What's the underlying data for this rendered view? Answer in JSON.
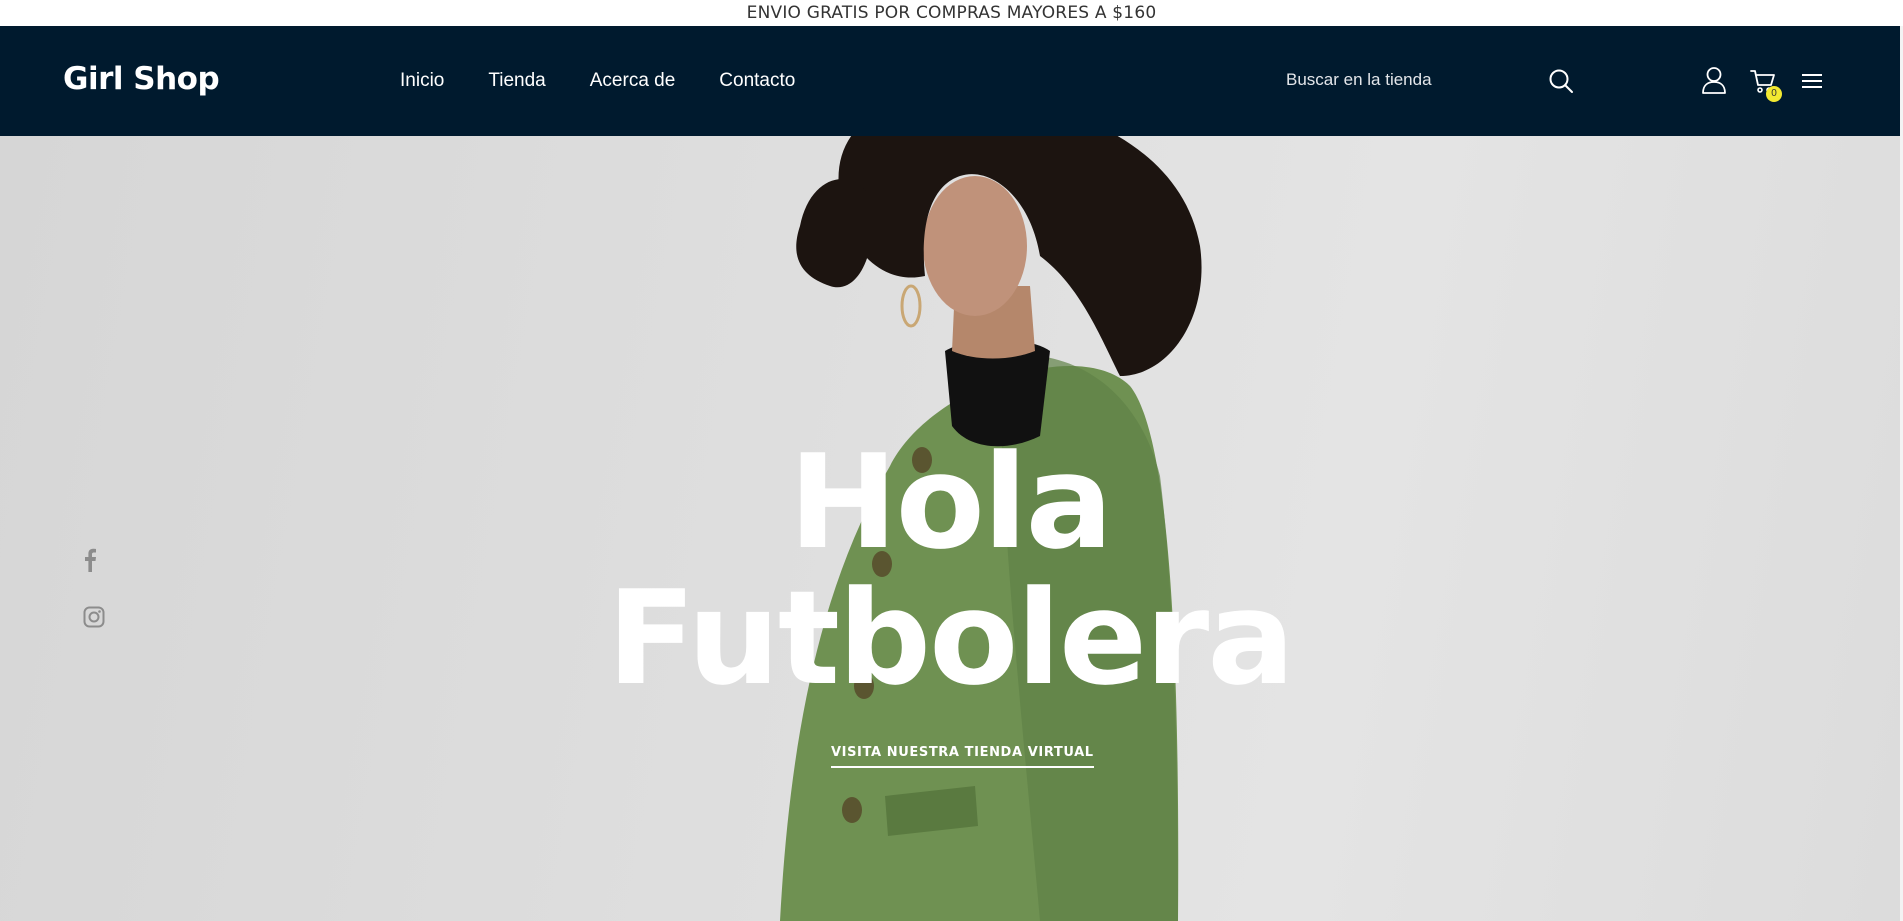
{
  "announcement": "ENVIO GRATIS POR COMPRAS MAYORES A $160",
  "header": {
    "logo": "Girl Shop",
    "nav": [
      "Inicio",
      "Tienda",
      "Acerca de",
      "Contacto"
    ],
    "search_placeholder": "Buscar en la tienda",
    "cart_count": "0",
    "icons": [
      "search-icon",
      "user-icon",
      "cart-icon",
      "menu-icon"
    ]
  },
  "hero": {
    "title_line1": "Hola",
    "title_line2": "Futbolera",
    "cta": "VISITA NUESTRA TIENDA VIRTUAL",
    "social_icons": [
      "facebook-icon",
      "instagram-icon"
    ]
  },
  "colors": {
    "navbar": "#001a2e",
    "badge": "#f2e931",
    "hero_bg": "#dedede",
    "jacket": "#6f9152"
  }
}
